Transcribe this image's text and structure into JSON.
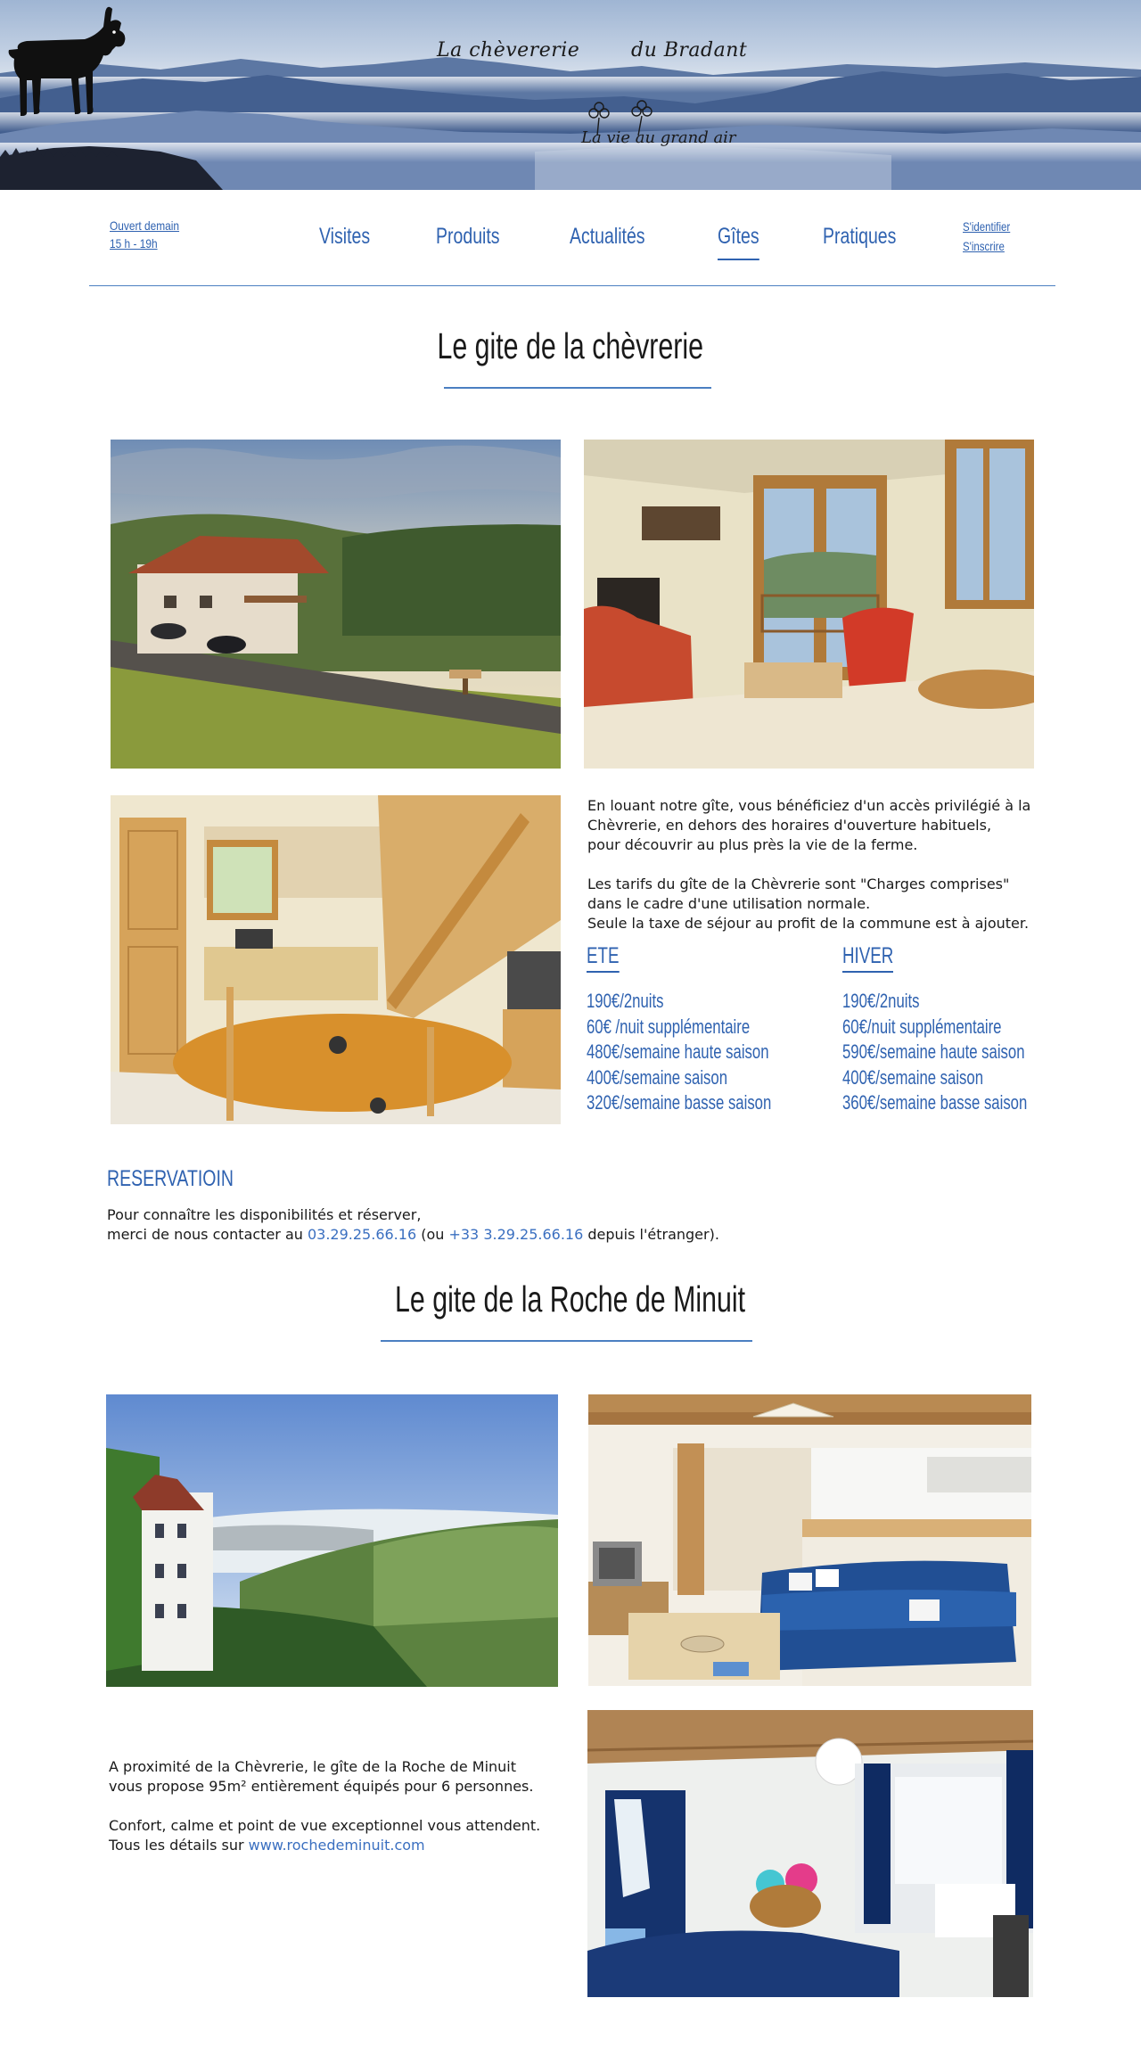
{
  "brand": {
    "name_part1": "La chèvererie",
    "name_part2": "du Bradant",
    "tagline": "La vie au grand air"
  },
  "nav": {
    "opening_line1": "Ouvert demain",
    "opening_line2": "15 h - 19h",
    "items": [
      {
        "label": "Visites",
        "active": false
      },
      {
        "label": "Produits",
        "active": false
      },
      {
        "label": "Actualités",
        "active": false
      },
      {
        "label": "Gîtes",
        "active": true
      },
      {
        "label": "Pratiques",
        "active": false
      }
    ],
    "login": "S'identifier",
    "register": "S'inscrire"
  },
  "gite1": {
    "title": "Le gite de la chèvrerie",
    "intro_line1": "En louant notre gîte, vous bénéficiez d'un accès privilégié à la",
    "intro_line2": "Chèvrerie, en dehors des horaires d'ouverture habituels,",
    "intro_line3": "pour découvrir au plus près la vie de la ferme.",
    "tarif_line1": "Les tarifs du gîte de la Chèvrerie sont \"Charges comprises\"",
    "tarif_line2": "dans le cadre d'une utilisation normale.",
    "tarif_line3": "Seule la taxe de séjour au profit de la commune est à ajouter.",
    "summer": {
      "title": "ETE",
      "prices": [
        "190€/2nuits",
        "60€ /nuit supplémentaire",
        "480€/semaine haute saison",
        "400€/semaine saison",
        "320€/semaine basse saison"
      ]
    },
    "winter": {
      "title": "HIVER",
      "prices": [
        "190€/2nuits",
        "60€/nuit supplémentaire",
        "590€/semaine haute saison",
        "400€/semaine saison",
        "360€/semaine basse saison"
      ]
    }
  },
  "reservation": {
    "title": "RESERVATIOIN",
    "line1": "Pour connaître les disponibilités et réserver,",
    "line2_prefix": "merci de nous contacter au ",
    "phone_local": "03.29.25.66.16",
    "line2_middle": " (ou ",
    "phone_intl": "+33 3.29.25.66.16",
    "line2_suffix": " depuis l'étranger)."
  },
  "gite2": {
    "title": "Le gite de la Roche de Minuit",
    "line1": "A proximité de la Chèvrerie, le gîte de la Roche de Minuit",
    "line2": "vous propose 95m² entièrement équipés pour 6 personnes.",
    "line3": "Confort, calme et point de vue exceptionnel vous attendent.",
    "line4_prefix": "Tous les détails sur ",
    "website": "www.rochedeminuit.com"
  },
  "colors": {
    "accent": "#2f62b0",
    "link": "#3a6fc0",
    "text": "#1a1a1a"
  }
}
